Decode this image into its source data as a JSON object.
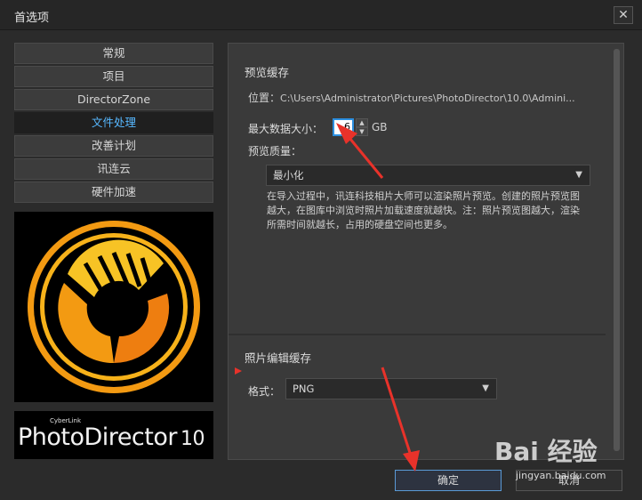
{
  "window": {
    "title": "首选项",
    "close_glyph": "✕"
  },
  "sidebar": {
    "items": [
      {
        "label": "常规",
        "active": false
      },
      {
        "label": "项目",
        "active": false
      },
      {
        "label": "DirectorZone",
        "active": false
      },
      {
        "label": "文件处理",
        "active": true
      },
      {
        "label": "改善计划",
        "active": false
      },
      {
        "label": "讯连云",
        "active": false
      },
      {
        "label": "硬件加速",
        "active": false
      }
    ]
  },
  "branding": {
    "maker": "CyberLink",
    "product": "PhotoDirector",
    "version": "10"
  },
  "preview_cache": {
    "heading": "预览缓存",
    "location_label": "位置：",
    "location_value": "C:\\Users\\Administrator\\Pictures\\PhotoDirector\\10.0\\Admini...",
    "max_size_label": "最大数据大小：",
    "max_size_value": "6",
    "max_size_unit": "GB",
    "quality_label": "预览质量：",
    "quality_value": "最小化",
    "description": "在导入过程中，讯连科技相片大师可以渲染照片预览。创建的照片预览图越大，在图库中浏览时照片加载速度就越快。注：照片预览图越大，渲染所需时间就越长，占用的硬盘空间也更多。"
  },
  "edit_cache": {
    "heading": "照片编辑缓存",
    "format_label": "格式：",
    "format_value": "PNG"
  },
  "footer": {
    "ok_label": "确定",
    "cancel_label": "取消"
  },
  "watermark": {
    "text": "Bai 经验",
    "url": "jingyan.baidu.com"
  },
  "colors": {
    "accent": "#57b8ff",
    "annotation_red": "#e8322a",
    "logo_orange": "#f39a12",
    "logo_yellow": "#f7c325"
  },
  "icons": {
    "close": "close-icon",
    "dropdown": "chevron-down-icon",
    "spin_up": "spin-up-icon",
    "spin_down": "spin-down-icon"
  }
}
